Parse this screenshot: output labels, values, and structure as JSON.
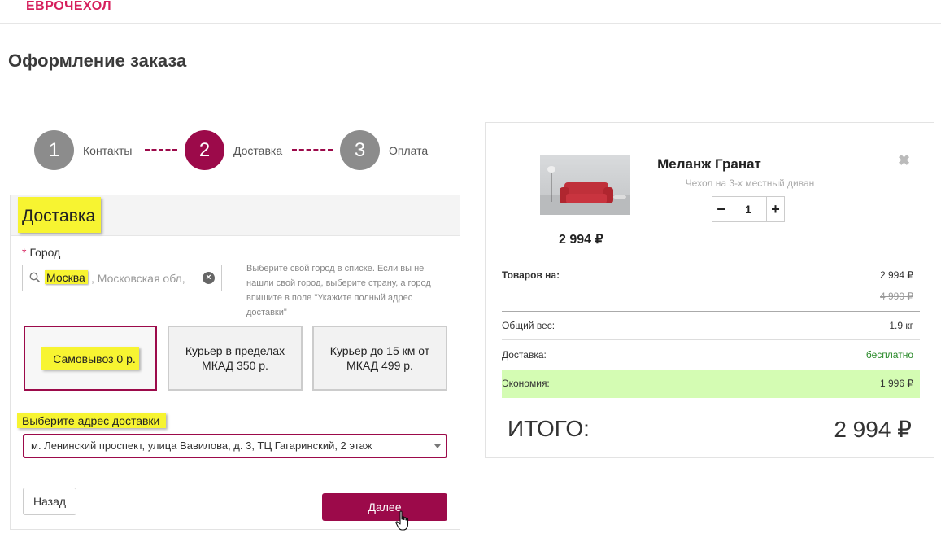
{
  "header": {
    "logo": "ЕВРОЧЕХОЛ"
  },
  "page_title": "Оформление заказа",
  "steps": [
    {
      "number": "1",
      "label": "Контакты",
      "state": "done"
    },
    {
      "number": "2",
      "label": "Доставка",
      "state": "active"
    },
    {
      "number": "3",
      "label": "Оплата",
      "state": "pending"
    }
  ],
  "delivery": {
    "title": "Доставка",
    "city_label": "Город",
    "city_required_mark": "*",
    "city_value_highlight": "Москва",
    "city_value_rest": ", Московская обл, Р",
    "city_hint": "Выберите свой город в списке. Если вы не нашли свой город, выберите страну, а город впишите в поле \"Укажите полный адрес доставки\"",
    "options": [
      {
        "label": "Самовывоз   0 р.",
        "selected": true
      },
      {
        "line1": "Курьер в пределах",
        "line2": "МКАД   350 р.",
        "selected": false
      },
      {
        "line1": "Курьер до 15 км от",
        "line2": "МКАД   499 р.",
        "selected": false
      }
    ],
    "address_label": "Выберите адрес доставки",
    "address_value": "м. Ленинский проспект, улица Вавилова, д. 3, ТЦ Гагаринский, 2 этаж",
    "back_label": "Назад",
    "next_label": "Далее"
  },
  "cart": {
    "item": {
      "name": "Меланж Гранат",
      "subtitle": "Чехол на 3-х местный диван",
      "quantity": "1",
      "price": "2 994 ₽",
      "minus": "−",
      "plus": "+"
    },
    "summary": {
      "goods_label": "Товаров на:",
      "goods_value": "2 994 ₽",
      "goods_old_value": "4 990 ₽",
      "weight_label": "Общий вес:",
      "weight_value": "1.9 кг",
      "delivery_label": "Доставка:",
      "delivery_value": "бесплатно",
      "savings_label": "Экономия:",
      "savings_value": "1 996 ₽",
      "total_label": "ИТОГО:",
      "total_value": "2 994 ₽"
    }
  },
  "colors": {
    "brand": "#9c0a4a",
    "logo": "#d61f5c",
    "highlight": "#f7f431",
    "savings_bg": "#d4fcb3",
    "free_delivery": "#2a8a2a"
  }
}
